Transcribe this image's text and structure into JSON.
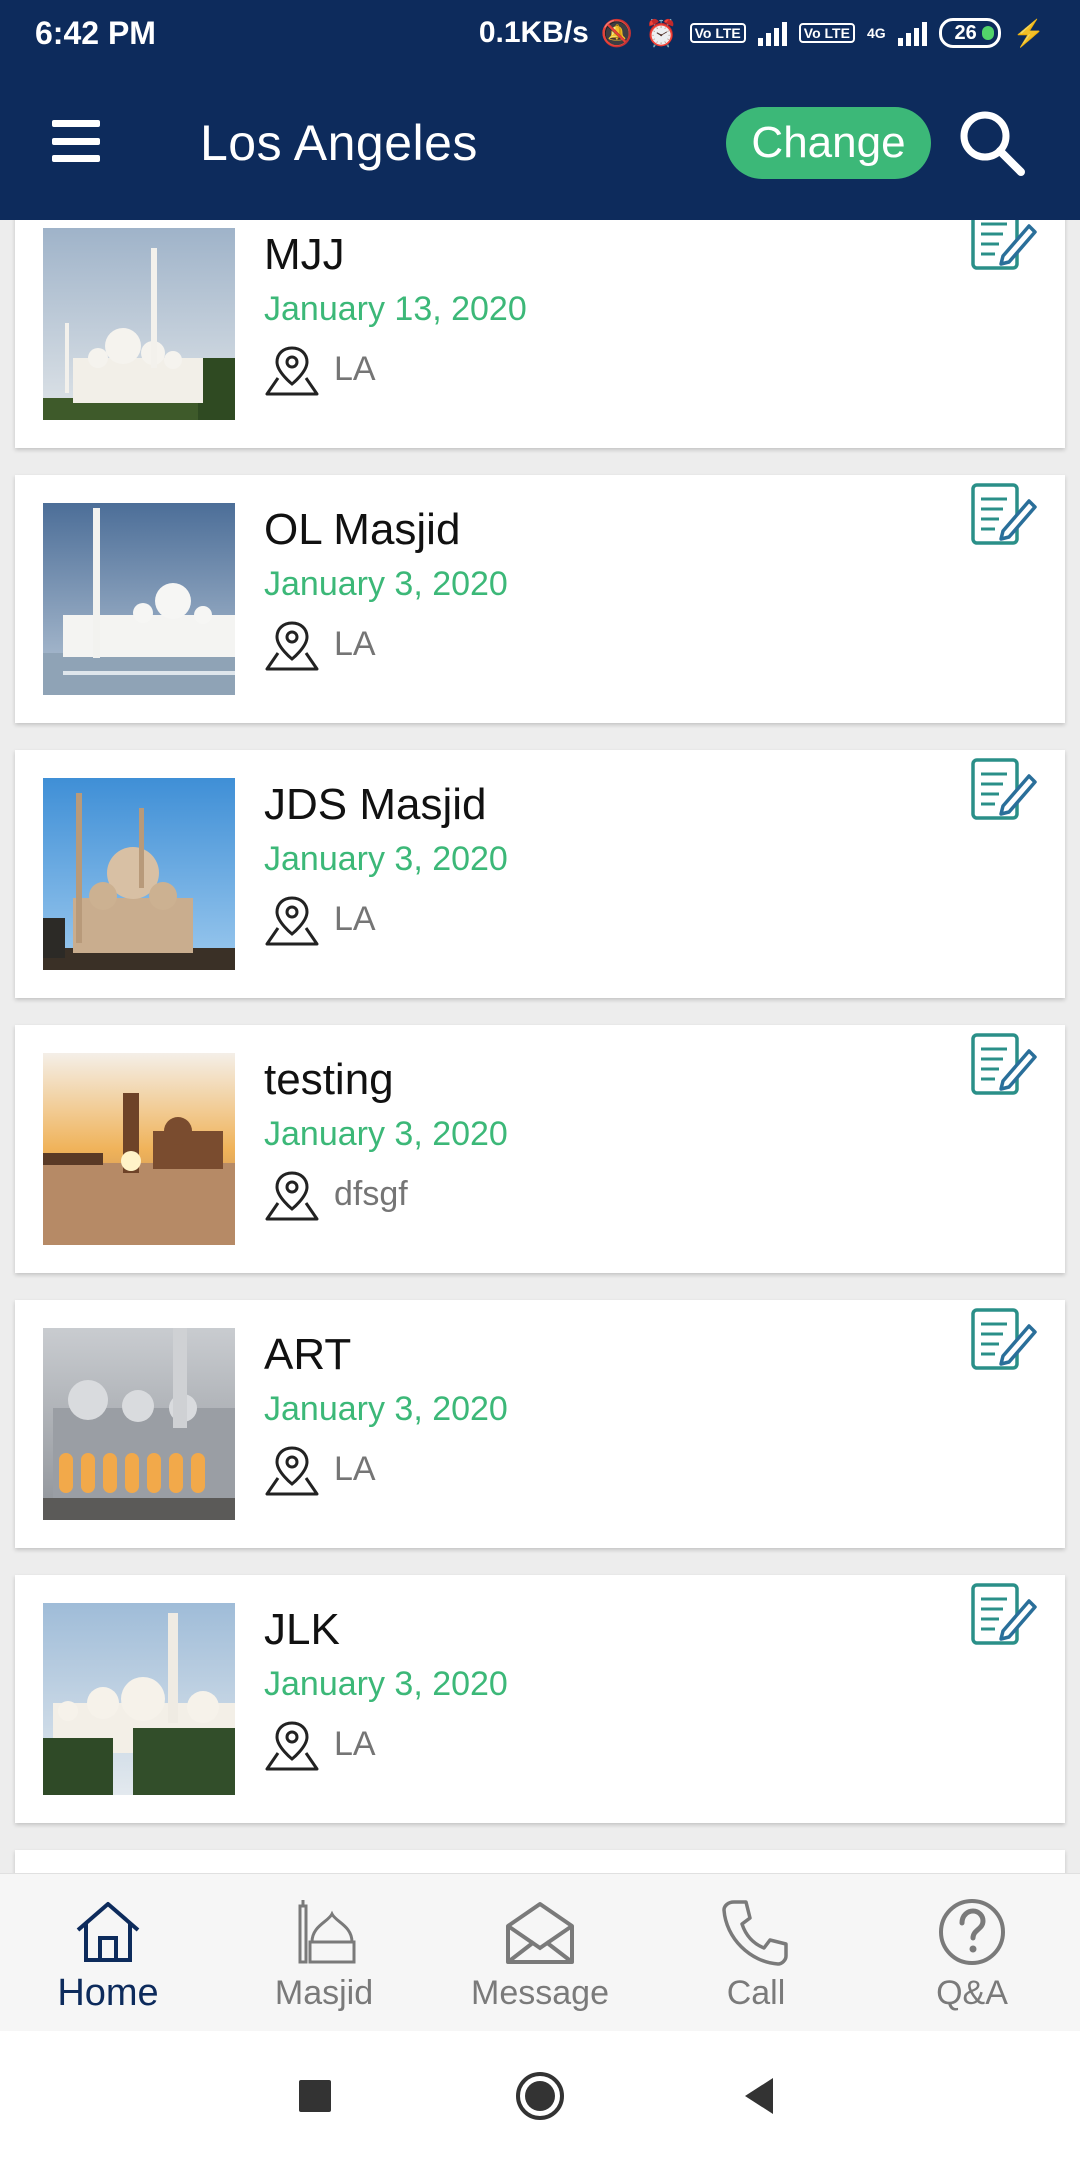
{
  "status_bar": {
    "time": "6:42 PM",
    "network_speed": "0.1KB/s",
    "volte_1": "Vo LTE",
    "volte_2": "Vo LTE",
    "network_type": "4G",
    "battery": "26"
  },
  "app_bar": {
    "title": "Los Angeles",
    "change_label": "Change"
  },
  "events": [
    {
      "title": "MJJ",
      "date": "January 13, 2020",
      "location": "LA"
    },
    {
      "title": "OL Masjid",
      "date": "January 3, 2020",
      "location": "LA"
    },
    {
      "title": "JDS Masjid",
      "date": "January 3, 2020",
      "location": "LA"
    },
    {
      "title": "testing",
      "date": "January 3, 2020",
      "location": "dfsgf"
    },
    {
      "title": "ART",
      "date": "January 3, 2020",
      "location": "LA"
    },
    {
      "title": "JLK",
      "date": "January 3, 2020",
      "location": "LA"
    }
  ],
  "bottom_nav": [
    {
      "label": "Home",
      "icon": "home-icon",
      "active": true
    },
    {
      "label": "Masjid",
      "icon": "mosque-icon",
      "active": false
    },
    {
      "label": "Message",
      "icon": "envelope-icon",
      "active": false
    },
    {
      "label": "Call",
      "icon": "phone-icon",
      "active": false
    },
    {
      "label": "Q&A",
      "icon": "question-icon",
      "active": false
    }
  ],
  "colors": {
    "primary": "#0d2b5c",
    "accent": "#3cb878",
    "edit_icon": "#2a8f88",
    "background": "#ededed"
  }
}
